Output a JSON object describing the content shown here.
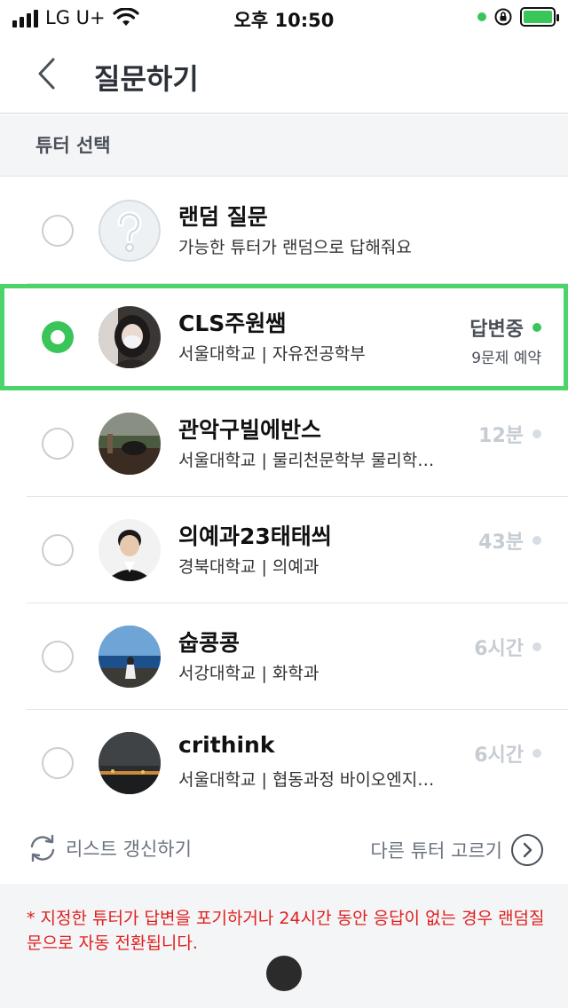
{
  "status_bar": {
    "carrier": "LG U+",
    "time": "오후 10:50"
  },
  "header": {
    "back_icon": "chevron-left-icon",
    "title": "질문하기"
  },
  "section": {
    "label": "튜터 선택"
  },
  "tutors": [
    {
      "name": "랜덤 질문",
      "subtitle": "가능한 튜터가 랜덤으로 답해줘요",
      "status": "",
      "reserve": "",
      "selected": false,
      "avatar": "question-mark-icon"
    },
    {
      "name": "CLS주원쌤",
      "subtitle": "서울대학교 | 자유전공학부",
      "status": "답변중",
      "reserve": "9문제 예약",
      "selected": true,
      "avatar": "person-photo"
    },
    {
      "name": "관악구빌에반스",
      "subtitle": "서울대학교 | 물리천문학부 물리학…",
      "status": "12분",
      "reserve": "",
      "selected": false,
      "avatar": "scenery-photo"
    },
    {
      "name": "의예과23태태씌",
      "subtitle": "경북대학교 | 의예과",
      "status": "43분",
      "reserve": "",
      "selected": false,
      "avatar": "person-photo"
    },
    {
      "name": "숩콩콩",
      "subtitle": "서강대학교 | 화학과",
      "status": "6시간",
      "reserve": "",
      "selected": false,
      "avatar": "ocean-photo"
    },
    {
      "name": "crithink",
      "subtitle": "서울대학교 | 협동과정 바이오엔지…",
      "status": "6시간",
      "reserve": "",
      "selected": false,
      "avatar": "night-photo"
    }
  ],
  "actions": {
    "refresh_label": "리스트 갱신하기",
    "pick_label": "다른 튜터 고르기"
  },
  "notice": "* 지정한 튜터가 답변을 포기하거나 24시간 동안 응답이 없는 경우 랜덤질문으로 자동 전환됩니다.",
  "colors": {
    "accent_green": "#3ac55a",
    "selected_border": "#4cd46a",
    "notice_red": "#e01e1e"
  }
}
